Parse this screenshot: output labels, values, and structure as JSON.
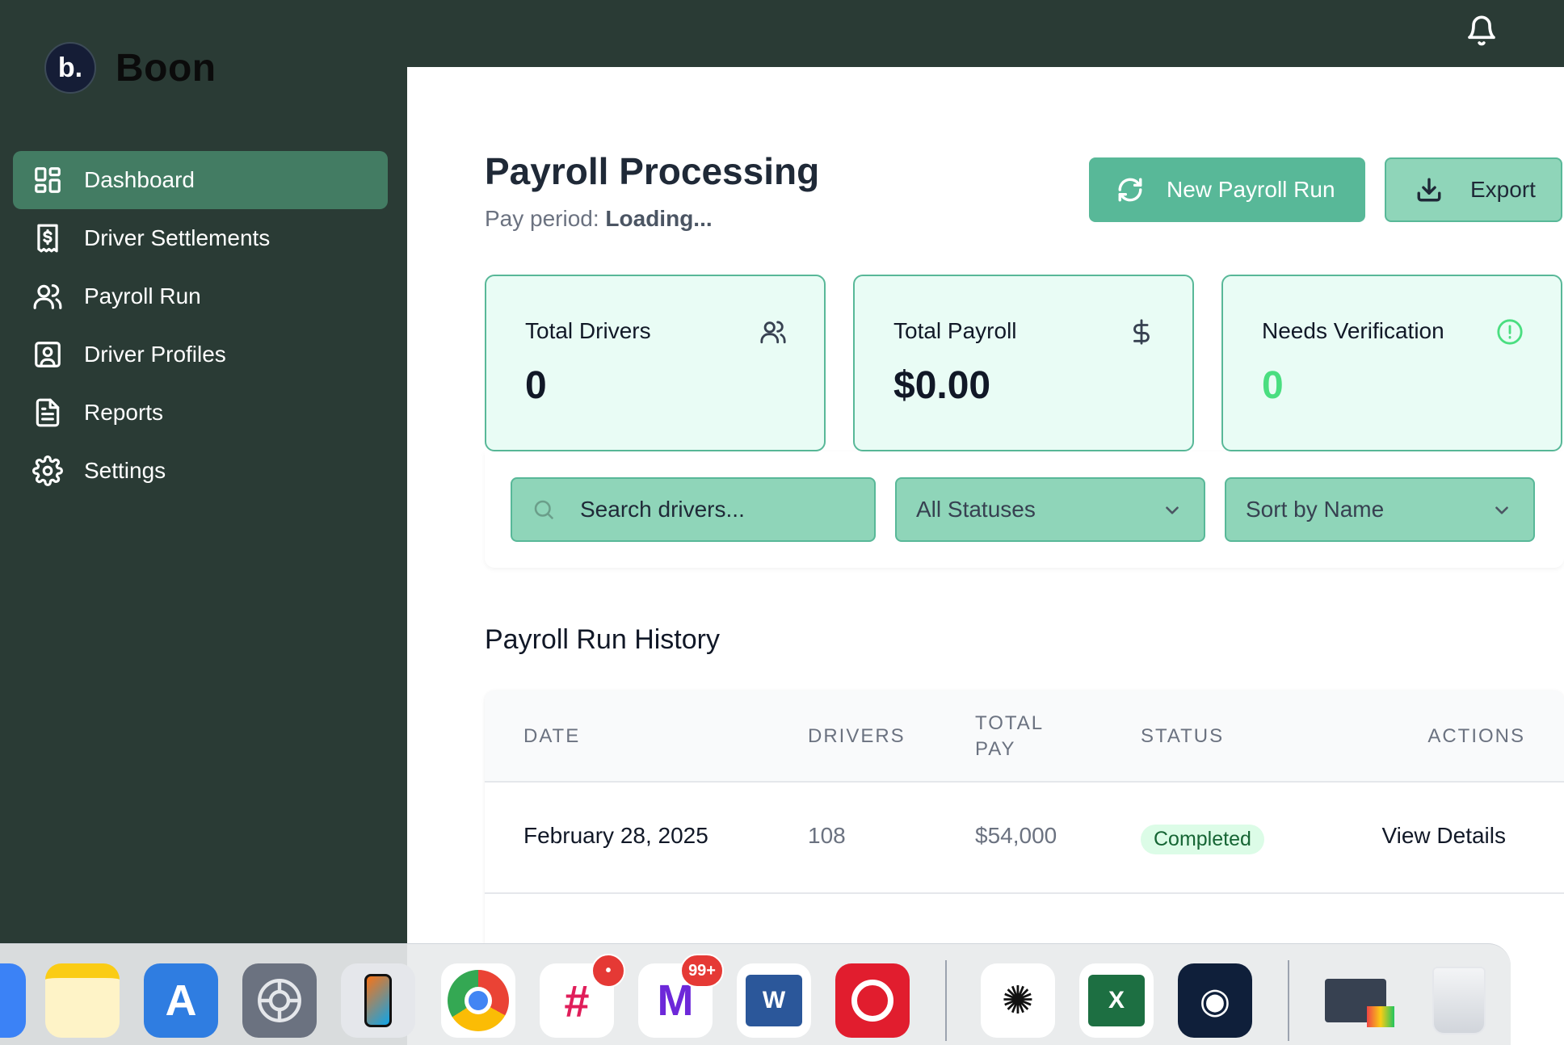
{
  "brand": {
    "logo_text": "b.",
    "name": "Boon"
  },
  "sidebar": {
    "items": [
      {
        "label": "Dashboard",
        "icon": "grid-icon",
        "active": true
      },
      {
        "label": "Driver Settlements",
        "icon": "receipt-dollar-icon"
      },
      {
        "label": "Payroll Run",
        "icon": "users-icon"
      },
      {
        "label": "Driver Profiles",
        "icon": "profile-card-icon"
      },
      {
        "label": "Reports",
        "icon": "document-icon"
      },
      {
        "label": "Settings",
        "icon": "gear-icon"
      }
    ]
  },
  "header": {
    "icon": "bell-icon"
  },
  "main": {
    "title": "Payroll Processing",
    "pay_period_label": "Pay period:",
    "pay_period_value": "Loading...",
    "buttons": {
      "new_run": "New Payroll Run",
      "export": "Export"
    },
    "cards": [
      {
        "label": "Total Drivers",
        "value": "0",
        "icon": "users-icon"
      },
      {
        "label": "Total Payroll",
        "value": "$0.00",
        "icon": "dollar-icon"
      },
      {
        "label": "Needs Verification",
        "value": "0",
        "icon": "alert-circle-icon"
      }
    ],
    "filters": {
      "search_placeholder": "Search drivers...",
      "status_selected": "All Statuses",
      "sort_selected": "Sort by Name"
    },
    "history": {
      "title": "Payroll Run History",
      "columns": [
        "DATE",
        "DRIVERS",
        "TOTAL PAY",
        "STATUS",
        "ACTIONS"
      ],
      "column_total_pay_lines": [
        "TOTAL",
        "PAY"
      ],
      "rows": [
        {
          "date": "February 28, 2025",
          "drivers": "108",
          "total_pay": "$54,000",
          "status": "Completed",
          "action": "View Details"
        }
      ]
    }
  },
  "colors": {
    "sidebar_bg": "#2a3b35",
    "active_nav": "#437c63",
    "accent": "#58b898",
    "accent_light": "#8fd5b9",
    "card_bg": "#e9fcf5",
    "verification_value": "#4ade80"
  },
  "dock": {
    "apps": [
      {
        "name": "notes-icon"
      },
      {
        "name": "app-store-icon"
      },
      {
        "name": "system-settings-icon"
      },
      {
        "name": "iphone-mirroring-icon"
      },
      {
        "name": "chrome-icon"
      },
      {
        "name": "slack-icon",
        "badge": "•"
      },
      {
        "name": "mail-icon",
        "badge": "99+"
      },
      {
        "name": "word-icon"
      },
      {
        "name": "record-icon"
      },
      {
        "name": "chatgpt-icon"
      },
      {
        "name": "excel-icon"
      },
      {
        "name": "owl-app-icon"
      },
      {
        "name": "pdf-tool-icon"
      },
      {
        "name": "trash-icon"
      }
    ]
  }
}
